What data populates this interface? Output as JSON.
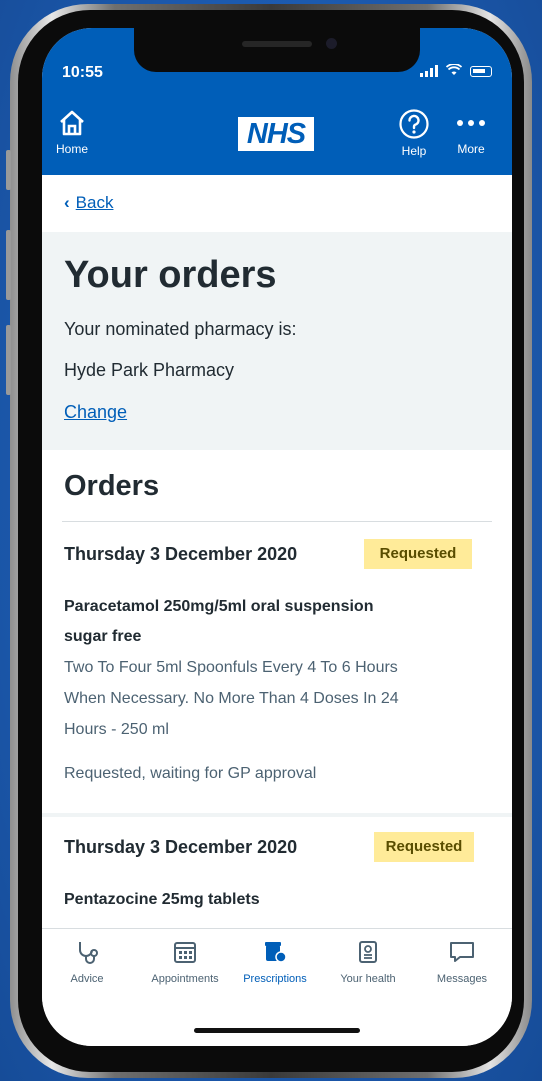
{
  "status_bar": {
    "time": "10:55"
  },
  "header": {
    "home_label": "Home",
    "logo_text": "NHS",
    "help_label": "Help",
    "more_label": "More"
  },
  "back": {
    "label": "Back"
  },
  "intro": {
    "title": "Your orders",
    "nominated_label": "Your nominated pharmacy is:",
    "pharmacy_name": "Hyde Park Pharmacy",
    "change_label": "Change"
  },
  "orders": {
    "title": "Orders",
    "items": [
      {
        "date": "Thursday 3 December 2020",
        "status_tag": "Requested",
        "medicine_line1": "Paracetamol 250mg/5ml oral suspension",
        "medicine_line2": "sugar free",
        "dosage_line1": "Two To Four 5ml Spoonfuls Every 4 To 6 Hours",
        "dosage_line2": "When Necessary. No More Than 4 Doses In 24",
        "dosage_line3": "Hours - 250 ml",
        "status_text": "Requested, waiting for GP approval"
      },
      {
        "date": "Thursday 3 December 2020",
        "status_tag": "Requested",
        "medicine_line1": "Pentazocine 25mg tablets"
      }
    ]
  },
  "tabbar": {
    "items": [
      {
        "label": "Advice",
        "icon": "stethoscope-icon"
      },
      {
        "label": "Appointments",
        "icon": "calendar-icon"
      },
      {
        "label": "Prescriptions",
        "icon": "prescription-icon",
        "active": true
      },
      {
        "label": "Your health",
        "icon": "health-record-icon"
      },
      {
        "label": "Messages",
        "icon": "message-icon"
      }
    ]
  },
  "colors": {
    "nhs_blue": "#005eb8",
    "text": "#212b32",
    "secondary_text": "#4c6272",
    "grey_bg": "#f0f4f5",
    "tag_bg": "#ffeb99",
    "tag_text": "#594d00"
  }
}
